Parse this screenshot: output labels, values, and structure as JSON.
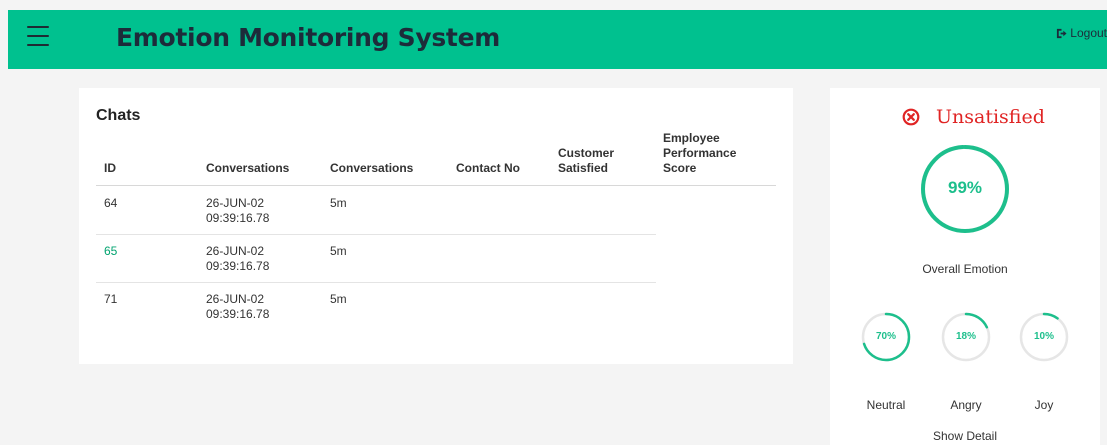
{
  "header": {
    "title": "Emotion Monitoring System",
    "logout_label": "Logout"
  },
  "colors": {
    "header_bg": "#00c18f",
    "accent": "#1dbf8c",
    "ring_track": "#e6e6e6",
    "danger": "#e02424",
    "link": "#00a36f"
  },
  "chats": {
    "title": "Chats",
    "columns": [
      "ID",
      "Conversations",
      "Conversations",
      "Contact No",
      "Customer Satisfied",
      "Employee Performance Score"
    ],
    "rows": [
      {
        "id": "64",
        "date": "26-JUN-02",
        "time": "09:39:16.78",
        "duration": "5m",
        "contact": "",
        "satisfied": "",
        "score": ""
      },
      {
        "id": "65",
        "date": "26-JUN-02",
        "time": "09:39:16.78",
        "duration": "5m",
        "contact": "",
        "satisfied": "",
        "score": ""
      },
      {
        "id": "71",
        "date": "26-JUN-02",
        "time": "09:39:16.78",
        "duration": "5m",
        "contact": "",
        "satisfied": "",
        "score": ""
      }
    ]
  },
  "emotion": {
    "status": "Unsatisfied",
    "status_icon": "x-circle-icon",
    "overall": {
      "value": 99,
      "text": "99%",
      "label": "Overall Emotion"
    },
    "breakdown": [
      {
        "name": "Neutral",
        "value": 70,
        "text": "70%"
      },
      {
        "name": "Angry",
        "value": 18,
        "text": "18%"
      },
      {
        "name": "Joy",
        "value": 10,
        "text": "10%"
      }
    ],
    "show_detail_label": "Show Detail"
  }
}
